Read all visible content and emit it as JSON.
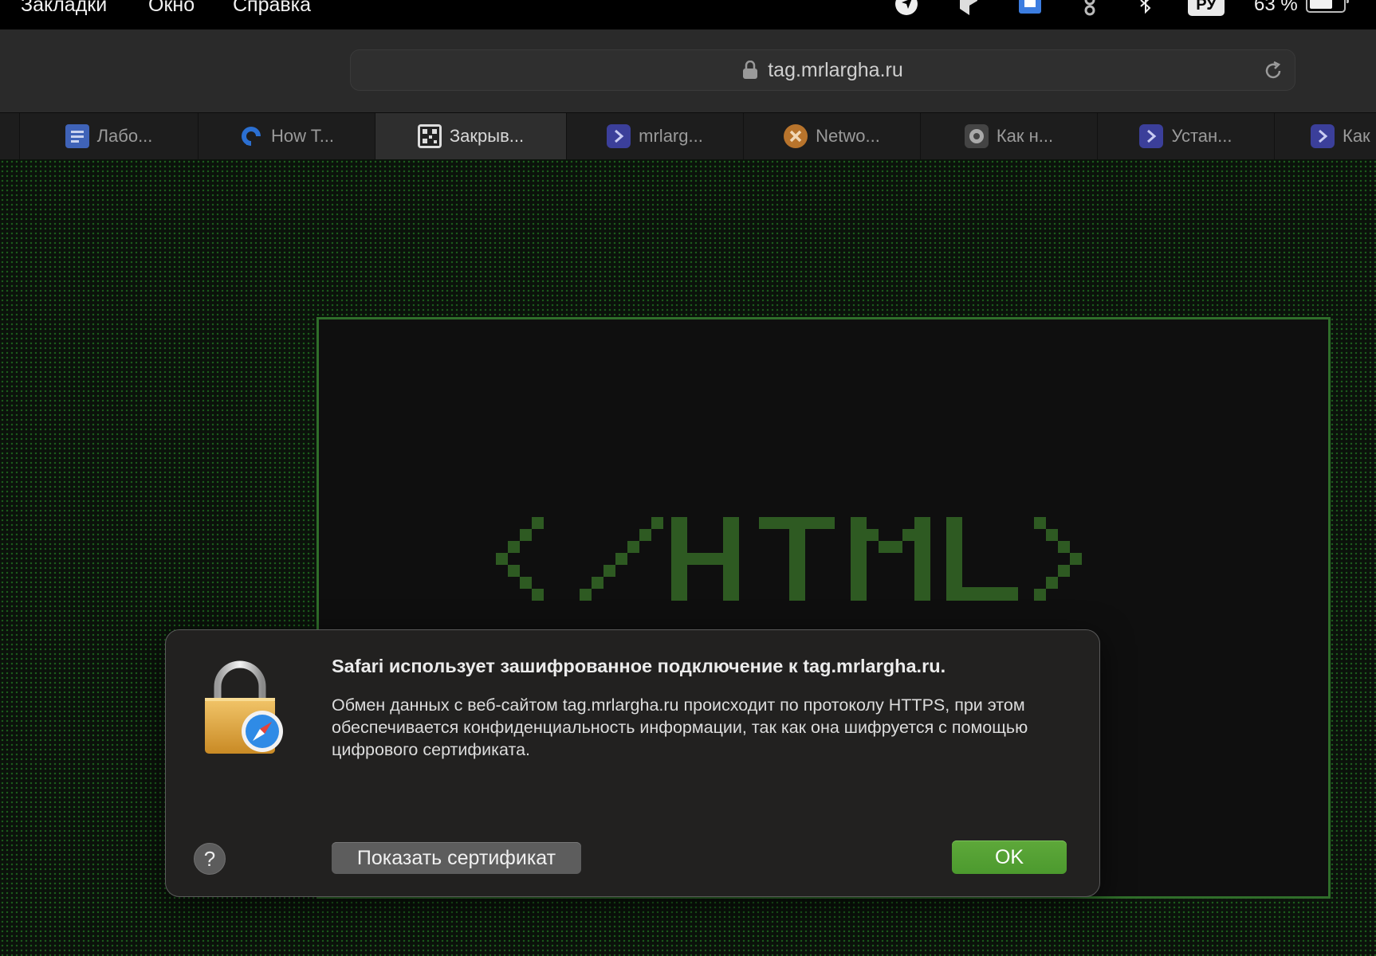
{
  "menubar": {
    "items": [
      "Закладки",
      "Окно",
      "Справка"
    ],
    "language": "РУ",
    "battery_percent": "63 %"
  },
  "toolbar": {
    "url": "tag.mrlargha.ru"
  },
  "tabs": [
    {
      "label": "Лабо...",
      "icon": "docs-icon",
      "active": false
    },
    {
      "label": "How T...",
      "icon": "digitalocean-icon",
      "active": false
    },
    {
      "label": "Закрыв...",
      "icon": "qr-icon",
      "active": true
    },
    {
      "label": "mrlarg...",
      "icon": "terminal-icon",
      "active": false
    },
    {
      "label": "Netwo...",
      "icon": "x-icon",
      "active": false
    },
    {
      "label": "Как н...",
      "icon": "gear-site-icon",
      "active": false
    },
    {
      "label": "Устан...",
      "icon": "terminal-icon",
      "active": false
    },
    {
      "label": "Как",
      "icon": "terminal-icon",
      "active": false
    }
  ],
  "page": {
    "logo_text": "</HTML>"
  },
  "dialog": {
    "title": "Safari использует зашифрованное подключение к tag.mrlargha.ru.",
    "body": "Обмен данных с веб-сайтом tag.mrlargha.ru происходит по протоколу HTTPS, при этом обеспечивается конфиденциальность информации, так как она шифруется с помощью цифрового сертификата.",
    "help_label": "?",
    "show_cert_label": "Показать сертификат",
    "ok_label": "OK"
  },
  "colors": {
    "accent_green": "#4c9a2e",
    "terminal_green": "#2f6e2a",
    "tab_icon_purple": "#3b3f9a"
  }
}
